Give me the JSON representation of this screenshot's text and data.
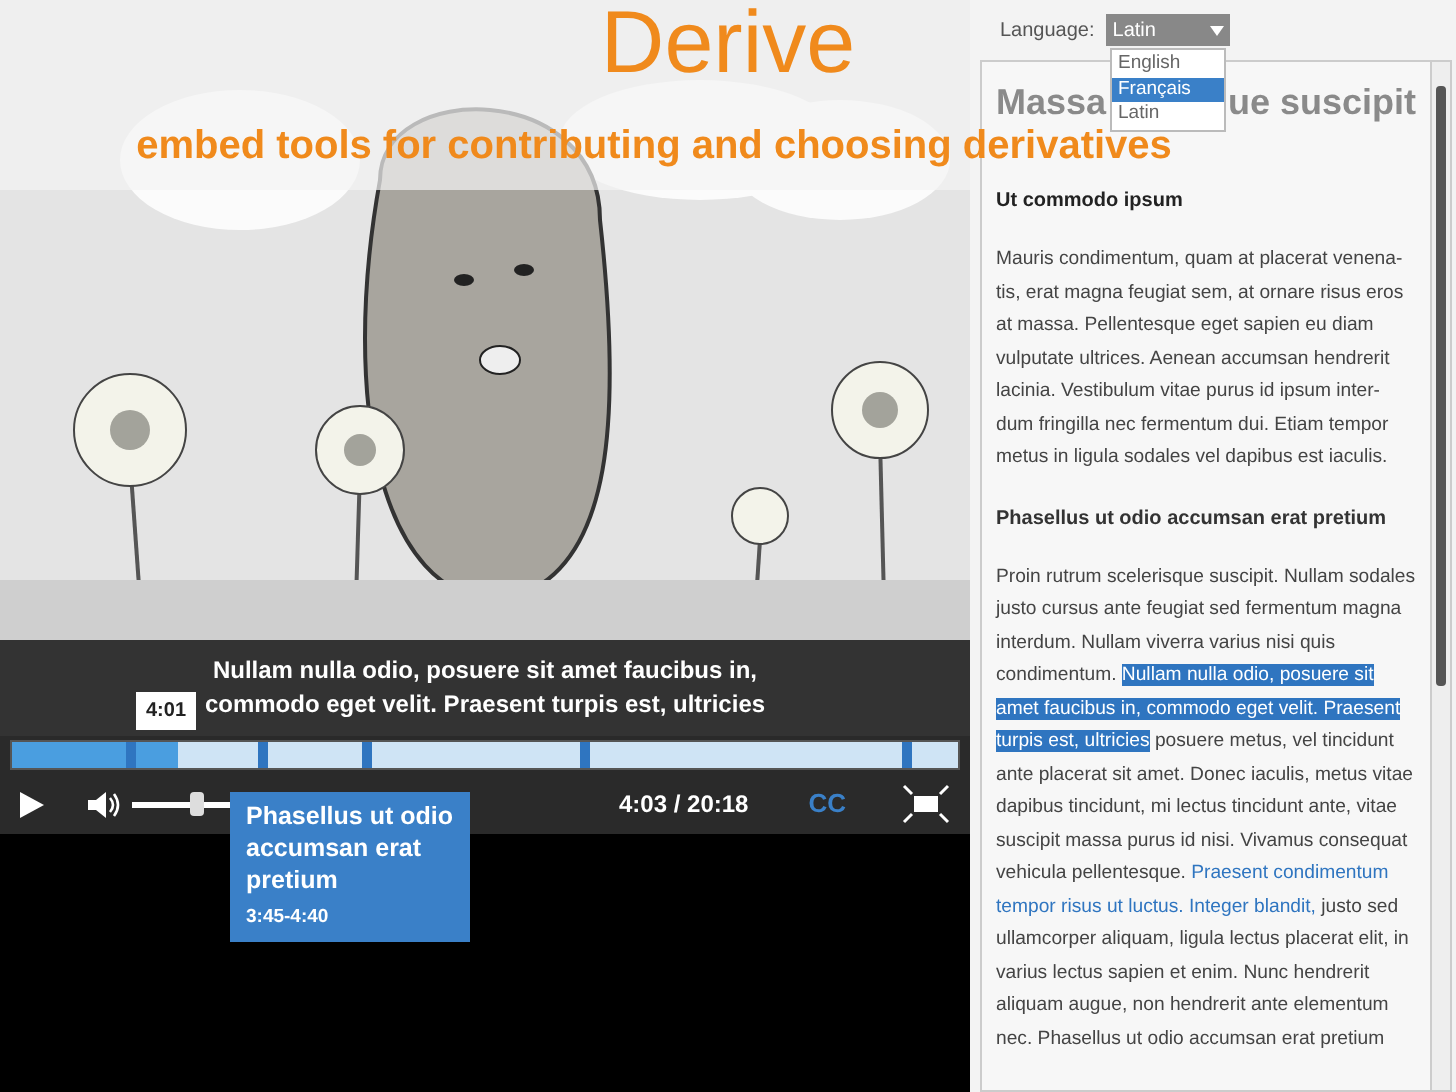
{
  "header": {
    "title": "Derive",
    "subtitle": "embed tools for contributing and choosing derivatives"
  },
  "player": {
    "caption": [
      "Nullam nulla odio, posuere sit amet faucibus in,",
      "commodo eget velit. Praesent turpis est, ultricies"
    ],
    "hover_time": "4:01",
    "progress": {
      "level": 0.175
    },
    "volume": {
      "level": 0.5
    },
    "time": "4:03 / 20:18",
    "cc": "CC",
    "chapter_popup": {
      "title": "Phasellus ut odio accumsan erat pretium",
      "time": "3:45-4:40"
    }
  },
  "transcript": {
    "language": {
      "label": "Language:",
      "value": "Latin",
      "options": [
        {
          "label": "English",
          "hovered": false
        },
        {
          "label": "Français",
          "hovered": true
        },
        {
          "label": "Latin",
          "hovered": false
        }
      ]
    },
    "heading_parts": [
      "Massa",
      "ue suscipit"
    ],
    "subheading": "Ut commodo ipsum",
    "blocks": [
      {
        "kind": "paragraph",
        "segments": [
          {
            "kind": "plain",
            "text": "Mauris condimentum, quam at placerat venena-tis, erat magna feugiat sem, at ornare risus eros at massa. Pellentesque eget sapien eu diam vulputate ultrices. Aenean accumsan hendrerit lacinia. Vestibulum vitae purus id ipsum inter-dum fringilla nec fermentum dui. Etiam tempor metus in ligula sodales vel dapibus est iaculis."
          }
        ]
      },
      {
        "kind": "heading",
        "text": "Phasellus ut odio accumsan erat pretium"
      },
      {
        "kind": "paragraph",
        "segments": [
          {
            "kind": "plain",
            "text": "Proin rutrum scelerisque suscipit. Nullam sodales justo cursus ante feugiat sed fermentum magna interdum. Nullam viverra varius nisi quis condimentum. "
          },
          {
            "kind": "highlight",
            "text": "Nullam nulla odio, posuere sit amet faucibus in, commodo eget velit. Praesent turpis est, ultricies"
          },
          {
            "kind": "plain",
            "text": " posuere metus, vel tincidunt ante placerat sit amet. Donec iaculis, metus vitae dapibus tincidunt, mi lectus tincidunt ante, vitae suscipit massa purus id nisi. Vivamus consequat vehicula pellentesque. "
          },
          {
            "kind": "link",
            "text": "Praesent condimentum"
          },
          {
            "kind": "link",
            "text": "tempor risus ut luctus. Integer blandit,"
          },
          {
            "kind": "plain",
            "text": " justo sed ullamcorper aliquam, ligula lectus placerat elit, in varius lectus sapien et enim. Nunc hendrerit aliquam augue, non hendrerit ante elementum nec. Phasellus ut odio accumsan erat pretium"
          }
        ]
      }
    ]
  }
}
